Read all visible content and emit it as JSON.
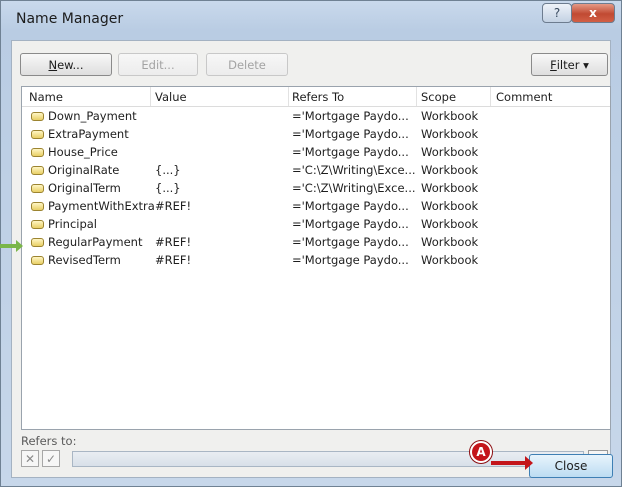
{
  "window": {
    "title": "Name Manager",
    "help_glyph": "?",
    "close_glyph": "x"
  },
  "toolbar": {
    "new_label_under": "N",
    "new_label_rest": "ew...",
    "edit_label": "Edit...",
    "delete_label": "Delete",
    "filter_label_under": "F",
    "filter_label_rest": "ilter ▾"
  },
  "list": {
    "columns": [
      "Name",
      "Value",
      "Refers To",
      "Scope",
      "Comment"
    ],
    "rows": [
      {
        "name": "Down_Payment",
        "value": "",
        "refers_to": "='Mortgage Paydo...",
        "scope": "Workbook",
        "comment": ""
      },
      {
        "name": "ExtraPayment",
        "value": "",
        "refers_to": "='Mortgage Paydo...",
        "scope": "Workbook",
        "comment": ""
      },
      {
        "name": "House_Price",
        "value": "",
        "refers_to": "='Mortgage Paydo...",
        "scope": "Workbook",
        "comment": ""
      },
      {
        "name": "OriginalRate",
        "value": "{...}",
        "refers_to": "='C:\\Z\\Writing\\Exce...",
        "scope": "Workbook",
        "comment": ""
      },
      {
        "name": "OriginalTerm",
        "value": "{...}",
        "refers_to": "='C:\\Z\\Writing\\Exce...",
        "scope": "Workbook",
        "comment": ""
      },
      {
        "name": "PaymentWithExtra",
        "value": "#REF!",
        "refers_to": "='Mortgage Paydo...",
        "scope": "Workbook",
        "comment": ""
      },
      {
        "name": "Principal",
        "value": "",
        "refers_to": "='Mortgage Paydo...",
        "scope": "Workbook",
        "comment": ""
      },
      {
        "name": "RegularPayment",
        "value": "#REF!",
        "refers_to": "='Mortgage Paydo...",
        "scope": "Workbook",
        "comment": ""
      },
      {
        "name": "RevisedTerm",
        "value": "#REF!",
        "refers_to": "='Mortgage Paydo...",
        "scope": "Workbook",
        "comment": ""
      }
    ]
  },
  "refers_to": {
    "label": "Refers to:",
    "value": "",
    "cancel_glyph": "✕",
    "confirm_glyph": "✓"
  },
  "footer": {
    "close_label": "Close"
  },
  "callout": {
    "label": "A"
  },
  "colors": {
    "callout": "#c4151a",
    "side_arrow": "#7ab648",
    "title_gradient_top": "#c9d9ec"
  }
}
